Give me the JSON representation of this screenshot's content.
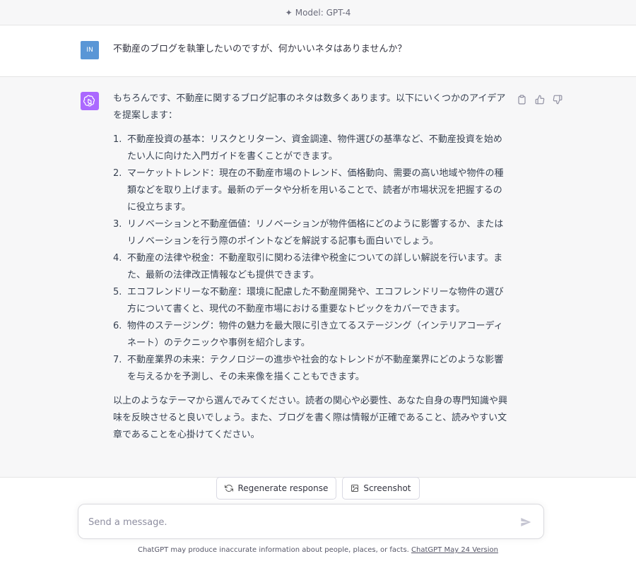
{
  "header": {
    "model_label": "Model: GPT-4"
  },
  "user_message": {
    "avatar_text": "IN",
    "text": "不動産のブログを執筆したいのですが、何かいいネタはありませんか？"
  },
  "assistant_message": {
    "intro": "もちろんです、不動産に関するブログ記事のネタは数多くあります。以下にいくつかのアイデアを提案します：",
    "items": [
      {
        "num": "1.",
        "text": "不動産投資の基本：リスクとリターン、資金調達、物件選びの基準など、不動産投資を始めたい人に向けた入門ガイドを書くことができます。"
      },
      {
        "num": "2.",
        "text": "マーケットトレンド：現在の不動産市場のトレンド、価格動向、需要の高い地域や物件の種類などを取り上げます。最新のデータや分析を用いることで、読者が市場状況を把握するのに役立ちます。"
      },
      {
        "num": "3.",
        "text": "リノベーションと不動産価値：リノベーションが物件価格にどのように影響するか、またはリノベーションを行う際のポイントなどを解説する記事も面白いでしょう。"
      },
      {
        "num": "4.",
        "text": "不動産の法律や税金：不動産取引に関わる法律や税金についての詳しい解説を行います。また、最新の法律改正情報なども提供できます。"
      },
      {
        "num": "5.",
        "text": "エコフレンドリーな不動産：環境に配慮した不動産開発や、エコフレンドリーな物件の選び方について書くと、現代の不動産市場における重要なトピックをカバーできます。"
      },
      {
        "num": "6.",
        "text": "物件のステージング：物件の魅力を最大限に引き立てるステージング（インテリアコーディネート）のテクニックや事例を紹介します。"
      },
      {
        "num": "7.",
        "text": "不動産業界の未来：テクノロジーの進歩や社会的なトレンドが不動産業界にどのような影響を与えるかを予測し、その未来像を描くこともできます。"
      }
    ],
    "outro": "以上のようなテーマから選んでみてください。読者の関心や必要性、あなた自身の専門知識や興味を反映させると良いでしょう。また、ブログを書く際は情報が正確であること、読みやすい文章であることを心掛けてください。"
  },
  "actions": {
    "regenerate_label": "Regenerate response",
    "screenshot_label": "Screenshot"
  },
  "composer": {
    "placeholder": "Send a message."
  },
  "footer": {
    "disclaimer": "ChatGPT may produce inaccurate information about people, places, or facts. ",
    "version_link": "ChatGPT May 24 Version"
  },
  "colors": {
    "user_avatar": "#5a96d6",
    "assistant_avatar": "#ab68ff"
  }
}
